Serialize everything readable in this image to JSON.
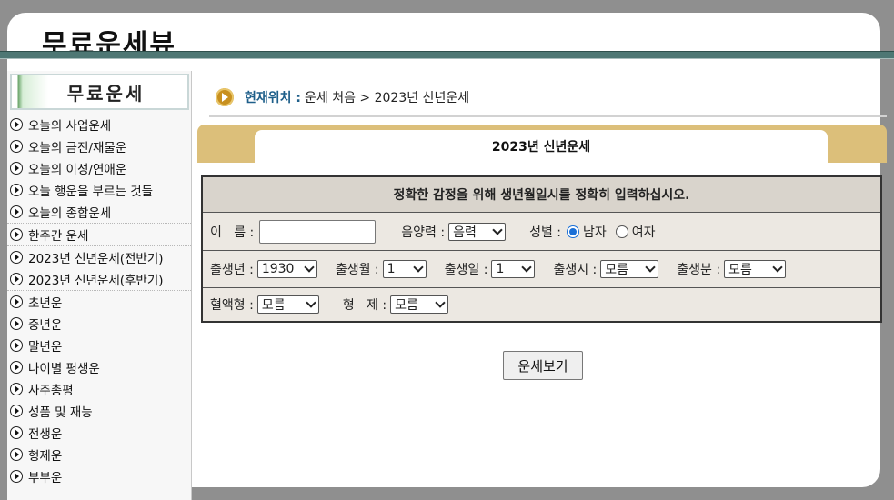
{
  "header": {
    "logo_text": "무료운세뷰"
  },
  "sidebar": {
    "title": "무료운세",
    "items": [
      {
        "label": "오늘의 사업운세"
      },
      {
        "label": "오늘의 금전/재물운"
      },
      {
        "label": "오늘의 이성/연애운"
      },
      {
        "label": "오늘 행운을 부르는 것들"
      },
      {
        "label": "오늘의 종합운세"
      },
      {
        "label": "한주간 운세"
      },
      {
        "label": "2023년 신년운세(전반기)"
      },
      {
        "label": "2023년 신년운세(후반기)"
      },
      {
        "label": "초년운"
      },
      {
        "label": "중년운"
      },
      {
        "label": "말년운"
      },
      {
        "label": "나이별 평생운"
      },
      {
        "label": "사주총평"
      },
      {
        "label": "성품 및 재능"
      },
      {
        "label": "전생운"
      },
      {
        "label": "형제운"
      },
      {
        "label": "부부운"
      }
    ]
  },
  "breadcrumb": {
    "label": "현재위치 :",
    "path": "운세 처음 > 2023년 신년운세"
  },
  "page_title": "2023년 신년운세",
  "form": {
    "instruction": "정확한 감정을 위해 생년월일시를 정확히 입력하십시오.",
    "name_label": "이   름 :",
    "name_value": "",
    "calendar_label": "음양력 :",
    "calendar_value": "음력",
    "gender_label": "성별 :",
    "gender_male": "남자",
    "gender_female": "여자",
    "gender_selected": "남자",
    "birth_year_label": "출생년 :",
    "birth_year_value": "1930",
    "birth_month_label": "출생월 :",
    "birth_month_value": "1",
    "birth_day_label": "출생일 :",
    "birth_day_value": "1",
    "birth_hour_label": "출생시 :",
    "birth_hour_value": "모름",
    "birth_minute_label": "출생분 :",
    "birth_minute_value": "모름",
    "blood_label": "혈액형 :",
    "blood_value": "모름",
    "siblings_label": "형   제 :",
    "siblings_value": "모름"
  },
  "submit_label": "운세보기",
  "colors": {
    "header_bar": "#4e7774",
    "title_band": "#dcbf7a",
    "form_bg": "#ece8e2",
    "breadcrumb_label": "#1e5f8a",
    "radio_accent": "#1a6fd6"
  }
}
